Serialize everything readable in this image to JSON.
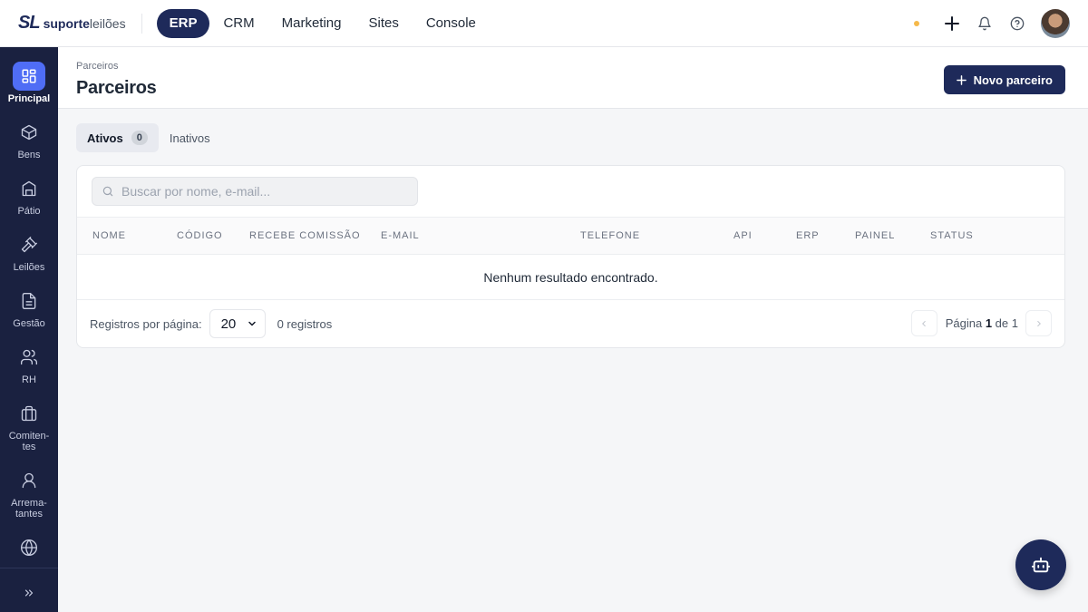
{
  "brand": {
    "mark": "SL",
    "name_bold": "suporte",
    "name_light": "leilões"
  },
  "topnav": [
    {
      "label": "ERP",
      "active": true
    },
    {
      "label": "CRM"
    },
    {
      "label": "Marketing"
    },
    {
      "label": "Sites"
    },
    {
      "label": "Console"
    }
  ],
  "sidebar": {
    "items": [
      {
        "label": "Principal",
        "icon": "grid-icon",
        "active": true
      },
      {
        "label": "Bens",
        "icon": "box-icon"
      },
      {
        "label": "Pátio",
        "icon": "warehouse-icon"
      },
      {
        "label": "Leilões",
        "icon": "gavel-icon"
      },
      {
        "label": "Gestão",
        "icon": "document-icon"
      },
      {
        "label": "RH",
        "icon": "users-icon"
      },
      {
        "label": "Comiten-\ntes",
        "icon": "briefcase-icon"
      },
      {
        "label": "Arrema-\ntantes",
        "icon": "user-icon"
      },
      {
        "label": "",
        "icon": "globe-icon"
      }
    ],
    "expand_icon": "chevrons-right-icon"
  },
  "header": {
    "breadcrumb": "Parceiros",
    "title": "Parceiros",
    "new_button": "Novo parceiro"
  },
  "tabs": [
    {
      "label": "Ativos",
      "badge": "0",
      "active": true
    },
    {
      "label": "Inativos"
    }
  ],
  "search": {
    "placeholder": "Buscar por nome, e-mail..."
  },
  "table": {
    "columns": [
      "NOME",
      "CÓDIGO",
      "RECEBE COMISSÃO",
      "E-MAIL",
      "TELEFONE",
      "API",
      "ERP",
      "PAINEL",
      "STATUS"
    ],
    "empty_message": "Nenhum resultado encontrado."
  },
  "footer": {
    "per_page_label": "Registros por página:",
    "per_page_value": "20",
    "count": "0 registros",
    "page_prefix": "Página",
    "page_current": "1",
    "page_sep": "de",
    "page_total": "1"
  },
  "colors": {
    "brand_navy": "#1e2a5a",
    "sidebar_bg": "#1a2140",
    "active_blue": "#4f6df5",
    "status_dot": "#f5b94a"
  }
}
